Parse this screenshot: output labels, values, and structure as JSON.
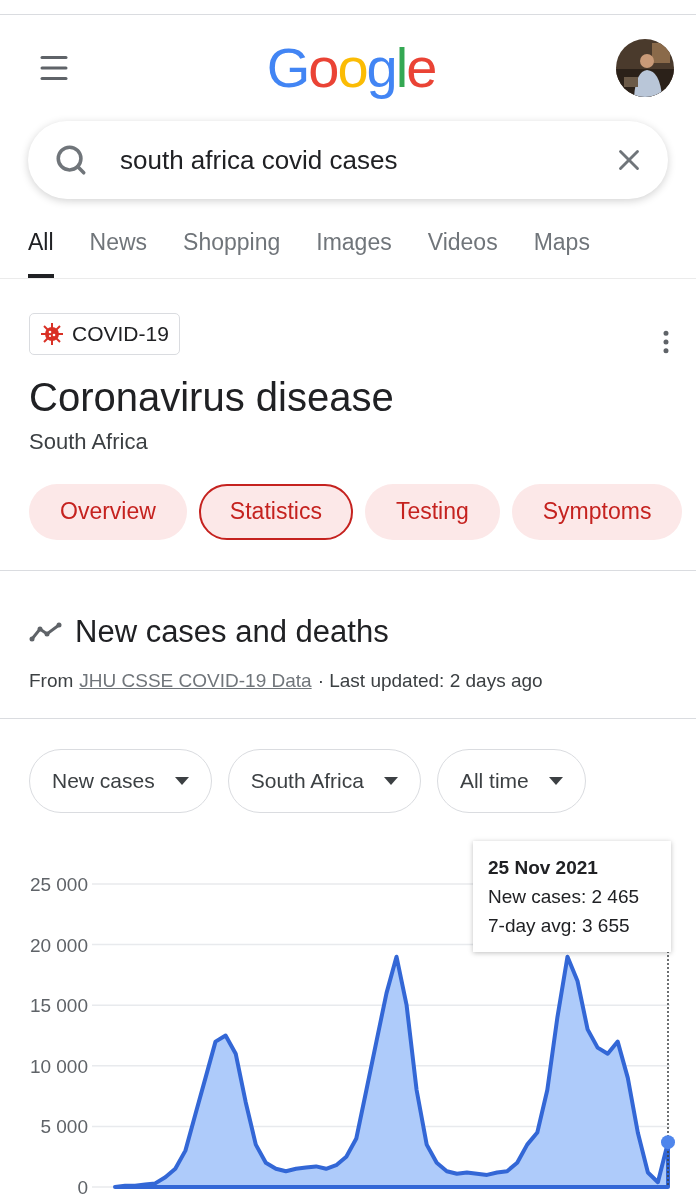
{
  "header": {
    "logo": [
      {
        "char": "G",
        "color": "#4285f4"
      },
      {
        "char": "o",
        "color": "#ea4335"
      },
      {
        "char": "o",
        "color": "#fbbc05"
      },
      {
        "char": "g",
        "color": "#4285f4"
      },
      {
        "char": "l",
        "color": "#34a853"
      },
      {
        "char": "e",
        "color": "#ea4335"
      }
    ]
  },
  "search": {
    "value": "south africa covid cases"
  },
  "tabs": [
    {
      "label": "All",
      "selected": true
    },
    {
      "label": "News",
      "selected": false
    },
    {
      "label": "Shopping",
      "selected": false
    },
    {
      "label": "Images",
      "selected": false
    },
    {
      "label": "Videos",
      "selected": false
    },
    {
      "label": "Maps",
      "selected": false
    }
  ],
  "card": {
    "badge": "COVID-19",
    "title": "Coronavirus disease",
    "subtitle": "South Africa",
    "pills": [
      {
        "label": "Overview",
        "selected": false
      },
      {
        "label": "Statistics",
        "selected": true
      },
      {
        "label": "Testing",
        "selected": false
      },
      {
        "label": "Symptoms",
        "selected": false
      }
    ]
  },
  "section": {
    "title": "New cases and deaths",
    "source_prefix": "From",
    "source_link": "JHU CSSE COVID-19 Data",
    "updated": "· Last updated: 2 days ago"
  },
  "filters": [
    "New cases",
    "South Africa",
    "All time"
  ],
  "chart": {
    "chart_data": {
      "type": "area",
      "grid": true,
      "ylim": [
        0,
        25000
      ],
      "yticks": [
        {
          "value": 0,
          "label": "0"
        },
        {
          "value": 5000,
          "label": "5 000"
        },
        {
          "value": 10000,
          "label": "10 000"
        },
        {
          "value": 15000,
          "label": "15 000"
        },
        {
          "value": 20000,
          "label": "20 000"
        },
        {
          "value": 25000,
          "label": "25 000"
        }
      ],
      "categories": [
        null,
        null,
        null,
        null,
        null,
        null,
        null,
        null,
        null,
        null,
        null,
        null,
        null,
        null,
        null,
        null,
        null,
        null,
        null,
        null,
        null,
        null,
        null,
        null,
        null,
        null,
        null,
        null,
        null,
        null,
        null,
        null,
        null,
        null,
        null,
        null,
        null,
        null,
        null,
        null,
        null,
        null,
        null,
        null,
        null,
        null,
        null,
        null,
        null,
        null,
        null,
        null,
        null,
        null,
        null,
        null
      ],
      "series": [
        {
          "name": "7-day avg",
          "color": "#3367d6",
          "values": [
            0,
            100,
            100,
            200,
            300,
            800,
            1500,
            3000,
            6000,
            9000,
            12000,
            12500,
            11000,
            7000,
            3500,
            2000,
            1500,
            1300,
            1500,
            1600,
            1700,
            1500,
            1800,
            2500,
            4000,
            8000,
            12000,
            16000,
            19000,
            15000,
            8000,
            3500,
            2000,
            1300,
            1100,
            1200,
            1100,
            1000,
            1200,
            1300,
            2000,
            3500,
            4500,
            8000,
            14000,
            19000,
            17000,
            13000,
            11500,
            11000,
            12000,
            9000,
            4500,
            1200,
            400,
            3700
          ]
        }
      ]
    },
    "tooltip": {
      "date": "25 Nov 2021",
      "first_line": "New cases: 2 465",
      "avg_value": ": 3 655"
    }
  }
}
